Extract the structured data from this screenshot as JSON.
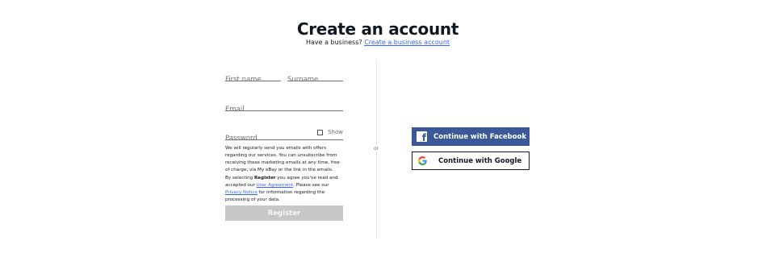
{
  "header": {
    "title": "Create an account",
    "business_prompt": "Have a business?",
    "business_link": "Create a business account"
  },
  "form": {
    "first_name_placeholder": "First name",
    "surname_placeholder": "Surname",
    "email_placeholder": "Email",
    "password_placeholder": "Password",
    "show_label": "Show",
    "marketing_notice": "We will regularly send you emails with offers regarding our services. You can unsubscribe from receiving these marketing emails at any time, free of charge, via My eBay or the link in the emails.",
    "agreement_prefix": "By selecting ",
    "agreement_register_word": "Register",
    "agreement_middle": " you agree you've read and accepted our ",
    "user_agreement_link": "User Agreement",
    "agreement_after_link": ". Please see our ",
    "privacy_notice_link": "Privacy Notice",
    "agreement_suffix": " for information regarding the processing of your data.",
    "register_label": "Register"
  },
  "divider": {
    "or_label": "or"
  },
  "social": {
    "facebook_label": "Continue with Facebook",
    "google_label": "Continue with Google",
    "facebook_color": "#3b5998",
    "google_icon": "google-g-icon",
    "facebook_icon": "facebook-f-icon"
  },
  "colors": {
    "link": "#3665f3",
    "register_disabled_bg": "#c7c7c7"
  }
}
